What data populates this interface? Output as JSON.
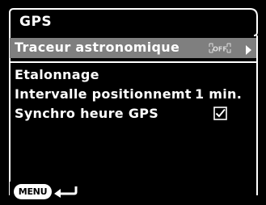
{
  "screen": {
    "title": "GPS",
    "selected_item": {
      "label": "Traceur astronomique",
      "status_icon": "off-icon",
      "status_text": "OFF",
      "arrow_icon": "right-arrow-icon"
    },
    "items": [
      {
        "label": "Etalonnage",
        "value": ""
      },
      {
        "label": "Intervalle positionnemt",
        "value": "1 min."
      },
      {
        "label": "Synchro heure GPS",
        "value": "",
        "checked": true
      }
    ],
    "footer": {
      "menu_label": "MENU",
      "back_icon": "back-arrow-icon"
    }
  },
  "colors": {
    "background": "#000000",
    "highlight": "#7f7f7f",
    "text": "#ffffff"
  }
}
